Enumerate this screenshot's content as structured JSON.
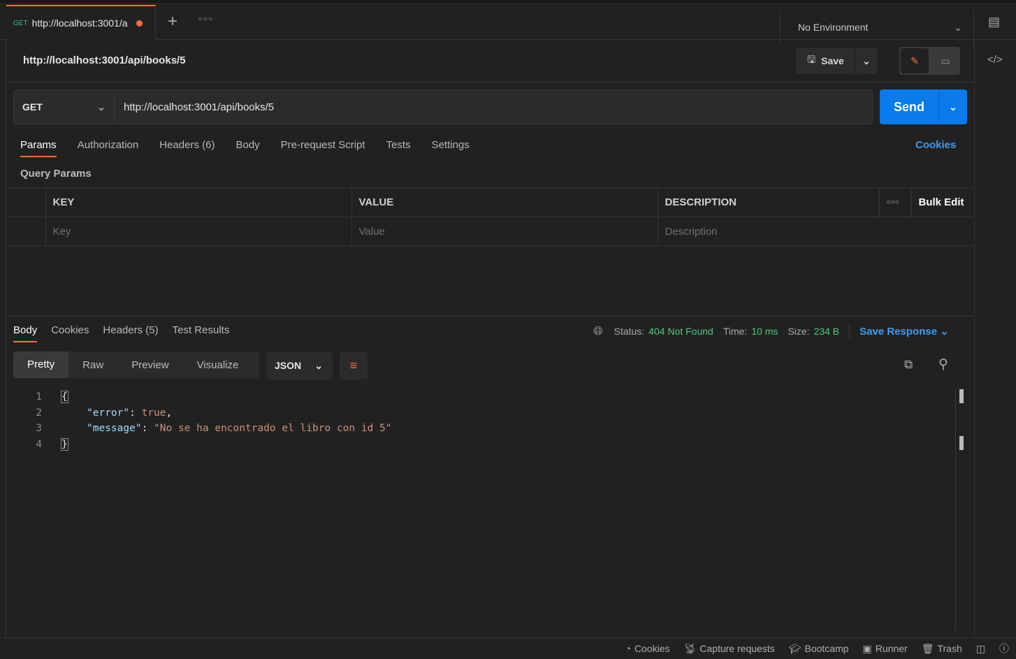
{
  "tab": {
    "method": "GET",
    "label": "http://localhost:3001/a"
  },
  "environment": "No Environment",
  "request": {
    "title": "http://localhost:3001/api/books/5",
    "save": "Save",
    "method": "GET",
    "url": "http://localhost:3001/api/books/5",
    "send": "Send"
  },
  "req_tabs": [
    {
      "label": "Params"
    },
    {
      "label": "Authorization"
    },
    {
      "label": "Headers",
      "count": "(6)"
    },
    {
      "label": "Body"
    },
    {
      "label": "Pre-request Script"
    },
    {
      "label": "Tests"
    },
    {
      "label": "Settings"
    }
  ],
  "cookies": "Cookies",
  "query_params": {
    "title": "Query Params",
    "headers": [
      "KEY",
      "VALUE",
      "DESCRIPTION"
    ],
    "bulk_edit": "Bulk Edit",
    "placeholders": [
      "Key",
      "Value",
      "Description"
    ]
  },
  "response": {
    "tabs": [
      {
        "label": "Body"
      },
      {
        "label": "Cookies"
      },
      {
        "label": "Headers",
        "count": "(5)"
      },
      {
        "label": "Test Results"
      }
    ],
    "status_label": "Status:",
    "status": "404 Not Found",
    "time_label": "Time:",
    "time": "10 ms",
    "size_label": "Size:",
    "size": "234 B",
    "save_response": "Save Response",
    "views": [
      "Pretty",
      "Raw",
      "Preview",
      "Visualize"
    ],
    "format": "JSON",
    "lines": [
      "1",
      "2",
      "3",
      "4"
    ],
    "code": {
      "open": "{",
      "k1": "\"error\"",
      "v1": "true",
      "k2": "\"message\"",
      "v2": "\"No se ha encontrado el libro con id 5\"",
      "close": "}"
    }
  },
  "footer": [
    "Cookies",
    "Capture requests",
    "Bootcamp",
    "Runner",
    "Trash"
  ]
}
